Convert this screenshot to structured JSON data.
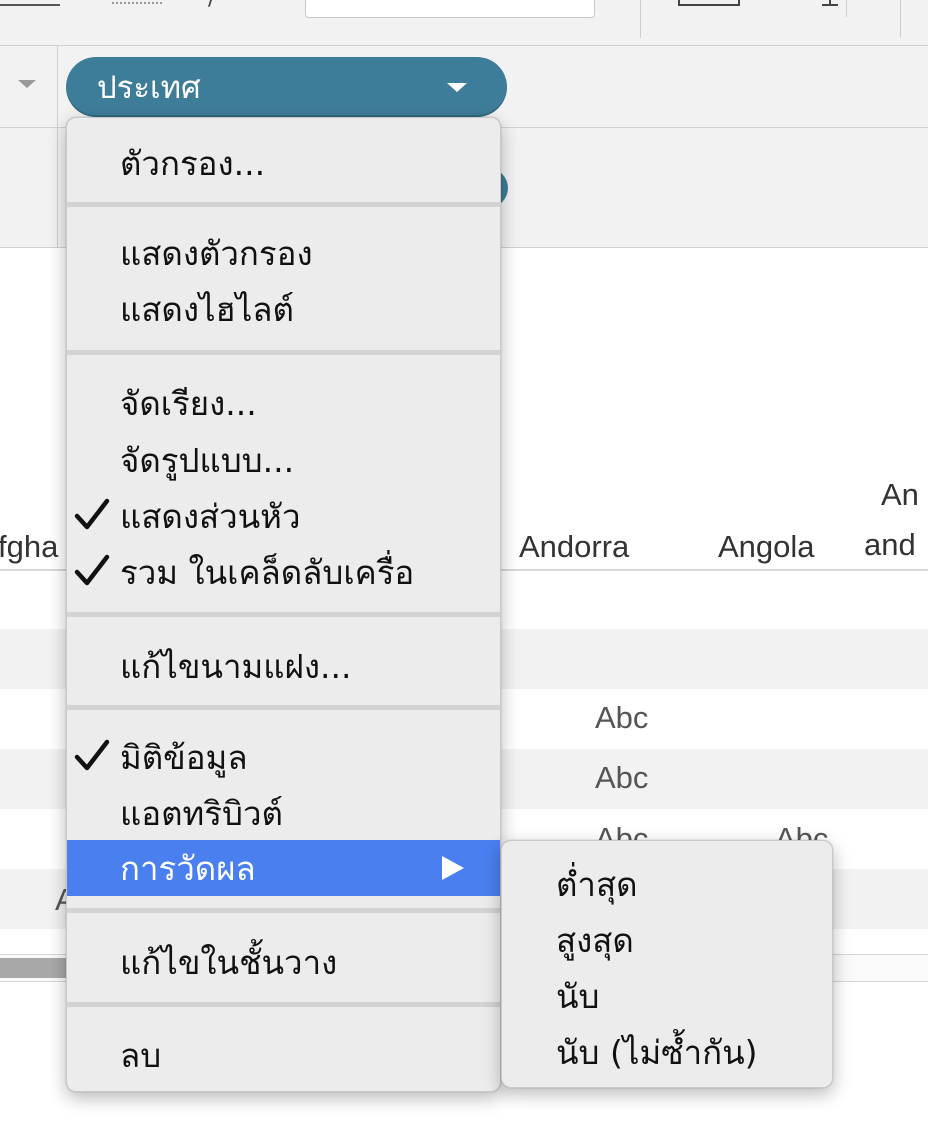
{
  "shelf": {
    "pill_label": "ประเทศ"
  },
  "grid": {
    "columns": [
      {
        "label": "fgha"
      },
      {
        "label": "Andorra"
      },
      {
        "label": "Angola"
      },
      {
        "label_line1": "An",
        "label_line2": "and"
      }
    ],
    "cells": [
      {
        "text": "Abc"
      },
      {
        "text": "Abc"
      },
      {
        "text": "Abc"
      },
      {
        "text": "Abc"
      },
      {
        "text": "A"
      }
    ]
  },
  "menu": {
    "filter": "ตัวกรอง...",
    "show_filter": "แสดงตัวกรอง",
    "show_highlight": "แสดงไฮไลต์",
    "sort": "จัดเรียง...",
    "format": "จัดรูปแบบ...",
    "show_header": "แสดงส่วนหัว",
    "include_tooltip": "รวม ในเคล็ดลับเครื่อ",
    "edit_alias": "แก้ไขนามแฝง...",
    "dimension": "มิติข้อมูล",
    "attribute": "แอตทริบิวต์",
    "measure": "การวัดผล",
    "edit_in_shelf": "แก้ไขในชั้นวาง",
    "remove": "ลบ",
    "checked": {
      "show_header": true,
      "include_tooltip": true,
      "dimension": true
    }
  },
  "submenu": {
    "items": [
      {
        "label": "ต่ำสุด"
      },
      {
        "label": "สูงสุด"
      },
      {
        "label": "นับ"
      },
      {
        "label": "นับ (ไม่ซ้ำกัน)"
      }
    ]
  },
  "colors": {
    "pill": "#3e7d99",
    "menu_highlight": "#4a7ff0",
    "menu_bg": "#ececec"
  },
  "icons": {
    "check": "checkmark-icon",
    "submenu_arrow": "triangle-right-icon",
    "dropdown": "caret-down-icon"
  }
}
